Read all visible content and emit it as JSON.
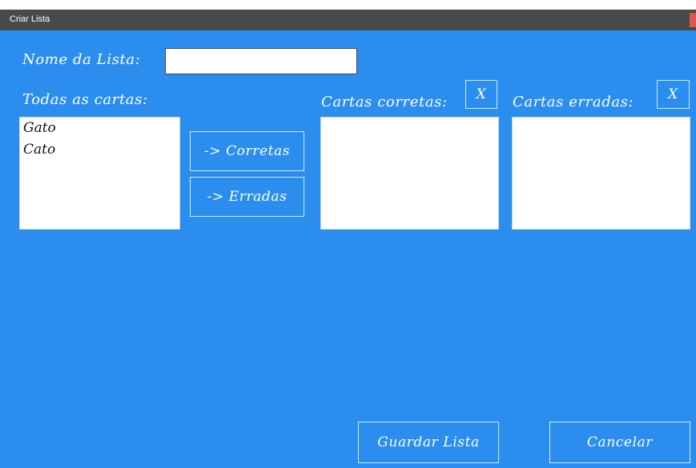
{
  "window": {
    "title": "Criar Lista"
  },
  "form": {
    "name_label": "Nome da Lista:",
    "name_value": "",
    "all_label": "Todas as cartas:",
    "correct_label": "Cartas corretas:",
    "wrong_label": "Cartas erradas:",
    "clear_correct": "X",
    "clear_wrong": "X",
    "to_correct": "-> Corretas",
    "to_wrong": "-> Erradas",
    "save": "Guardar Lista",
    "cancel": "Cancelar"
  },
  "all_cards": [
    "Gato",
    "Cato"
  ],
  "correct_cards": [],
  "wrong_cards": [],
  "colors": {
    "background": "#2b8eef",
    "titlebar": "#4a4a4a"
  }
}
